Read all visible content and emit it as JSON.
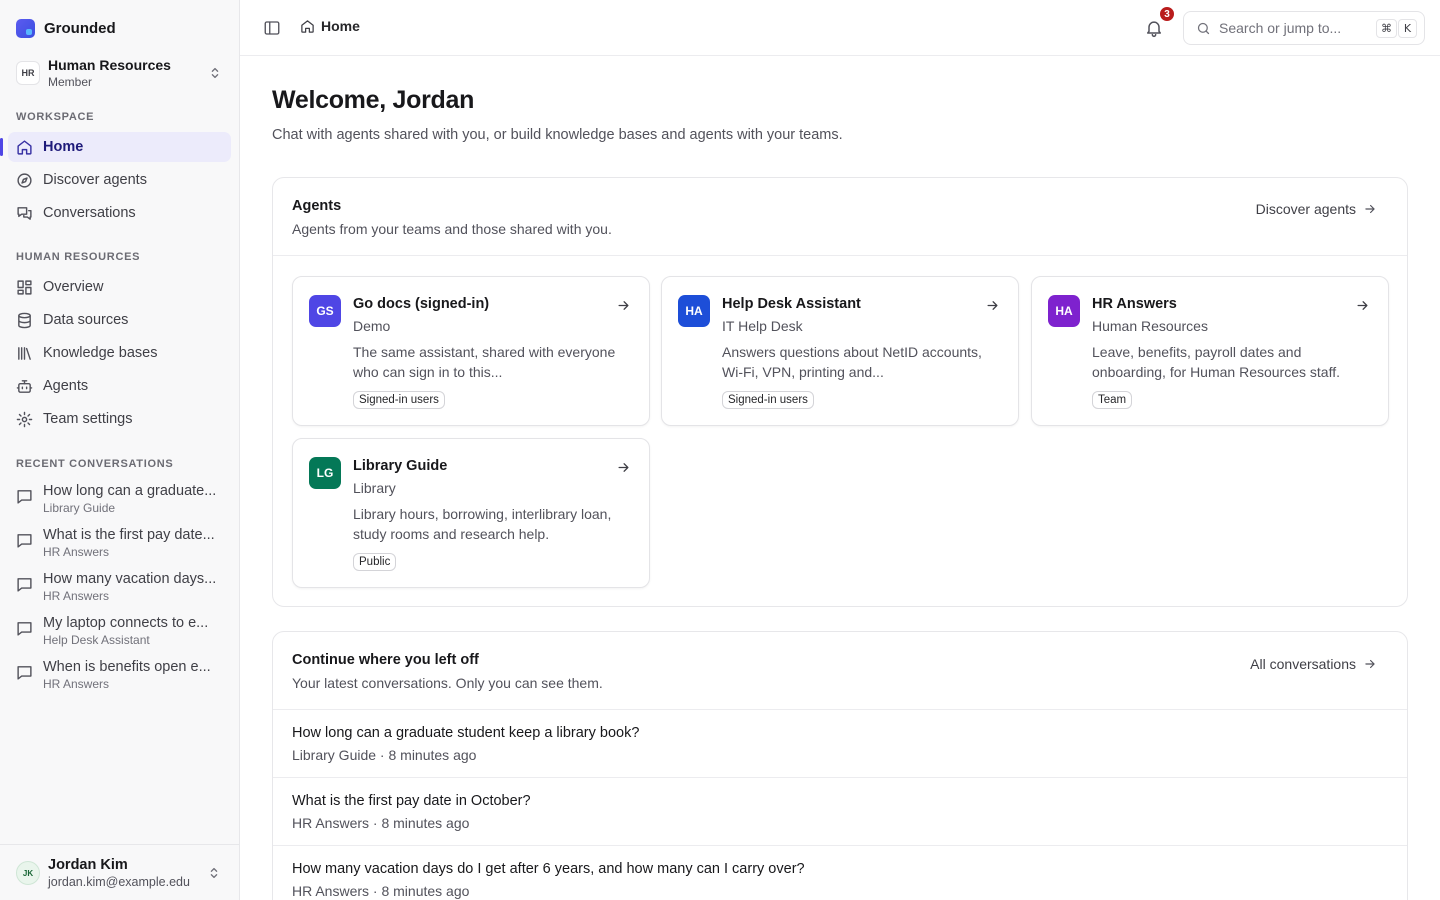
{
  "brand": {
    "name": "Grounded"
  },
  "team_switcher": {
    "initials": "HR",
    "name": "Human Resources",
    "role": "Member"
  },
  "sidebar": {
    "workspace_label": "WORKSPACE",
    "workspace_items": [
      {
        "label": "Home",
        "icon": "home-icon",
        "active": true
      },
      {
        "label": "Discover agents",
        "icon": "compass-icon"
      },
      {
        "label": "Conversations",
        "icon": "chat-bubbles-icon"
      }
    ],
    "team_label": "HUMAN RESOURCES",
    "team_items": [
      {
        "label": "Overview",
        "icon": "dashboard-grid-icon"
      },
      {
        "label": "Data sources",
        "icon": "database-icon"
      },
      {
        "label": "Knowledge bases",
        "icon": "library-icon"
      },
      {
        "label": "Agents",
        "icon": "bot-icon"
      },
      {
        "label": "Team settings",
        "icon": "gear-icon"
      }
    ],
    "recent_label": "RECENT CONVERSATIONS",
    "recent": [
      {
        "title": "How long can a graduate...",
        "agent": "Library Guide"
      },
      {
        "title": "What is the first pay date...",
        "agent": "HR Answers"
      },
      {
        "title": "How many vacation days...",
        "agent": "HR Answers"
      },
      {
        "title": "My laptop connects to e...",
        "agent": "Help Desk Assistant"
      },
      {
        "title": "When is benefits open e...",
        "agent": "HR Answers"
      }
    ]
  },
  "user": {
    "initials": "JK",
    "name": "Jordan Kim",
    "email": "jordan.kim@example.edu"
  },
  "topbar": {
    "breadcrumb": "Home",
    "notification_count": "3",
    "search_placeholder": "Search or jump to...",
    "shortcut_mod": "⌘",
    "shortcut_key": "K"
  },
  "main": {
    "title": "Welcome, Jordan",
    "subtitle": "Chat with agents shared with you, or build knowledge bases and agents with your teams."
  },
  "agents_panel": {
    "title": "Agents",
    "subtitle": "Agents from your teams and those shared with you.",
    "link": "Discover agents",
    "cards": [
      {
        "initials": "GS",
        "name": "Go docs (signed-in)",
        "team": "Demo",
        "desc": "The same assistant, shared with everyone who can sign in to this...",
        "badge": "Signed-in users",
        "color": "#4f46e5"
      },
      {
        "initials": "HA",
        "name": "Help Desk Assistant",
        "team": "IT Help Desk",
        "desc": "Answers questions about NetID accounts, Wi-Fi, VPN, printing and...",
        "badge": "Signed-in users",
        "color": "#1d4ed8"
      },
      {
        "initials": "HA",
        "name": "HR Answers",
        "team": "Human Resources",
        "desc": "Leave, benefits, payroll dates and onboarding, for Human Resources staff.",
        "badge": "Team",
        "color": "#7e22ce"
      },
      {
        "initials": "LG",
        "name": "Library Guide",
        "team": "Library",
        "desc": "Library hours, borrowing, interlibrary loan, study rooms and research help.",
        "badge": "Public",
        "color": "#047857"
      }
    ]
  },
  "conversations_panel": {
    "title": "Continue where you left off",
    "subtitle": "Your latest conversations. Only you can see them.",
    "link": "All conversations",
    "rows": [
      {
        "title": "How long can a graduate student keep a library book?",
        "meta": "Library Guide · 8 minutes ago"
      },
      {
        "title": "What is the first pay date in October?",
        "meta": "HR Answers · 8 minutes ago"
      },
      {
        "title": "How many vacation days do I get after 6 years, and how many can I carry over?",
        "meta": "HR Answers · 8 minutes ago"
      }
    ]
  }
}
